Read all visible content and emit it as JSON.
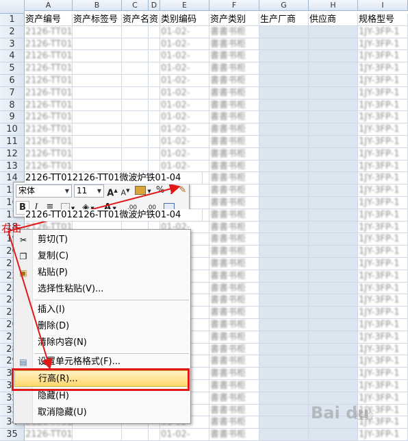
{
  "columns": [
    {
      "letter": "A",
      "header": "资产编号"
    },
    {
      "letter": "B",
      "header": "资产标签号"
    },
    {
      "letter": "C",
      "header": "资产名"
    },
    {
      "letter": "D",
      "header": "资"
    },
    {
      "letter": "E",
      "header": "类别编码"
    },
    {
      "letter": "F",
      "header": "资产类别"
    },
    {
      "letter": "G",
      "header": "生产厂商"
    },
    {
      "letter": "H",
      "header": "供应商"
    },
    {
      "letter": "I",
      "header": "规格型号"
    }
  ],
  "rows": [
    "1",
    "2",
    "3",
    "4",
    "5",
    "6",
    "7",
    "8",
    "9",
    "10",
    "11",
    "12",
    "13",
    "14",
    "15",
    "16",
    "17",
    "18",
    "19",
    "20",
    "21",
    "22",
    "23",
    "24",
    "25",
    "26",
    "27",
    "28",
    "29",
    "30",
    "31",
    "32",
    "33",
    "34",
    "35"
  ],
  "visible_row_text": {
    "r14": "2126-TT012126-TT01微波炉铁01-04",
    "r17": "2126-TT012126-TT01微波炉铁01-04"
  },
  "blurred_samples": {
    "a": "2126-TT012126-TT01",
    "e": "01-02-",
    "f": "書書书柜",
    "i": "1JY-3FP-1"
  },
  "mini_toolbar": {
    "font_name": "宋体",
    "font_size": "11",
    "grow": "A",
    "shrink": "A",
    "percent": "%",
    "comma": ",",
    "bold": "B",
    "italic": "I",
    "dec_inc": ".00",
    "dec_dec": ".00",
    "font_color_letter": "A"
  },
  "context_menu": {
    "items": [
      {
        "label": "剪切(T)"
      },
      {
        "label": "复制(C)"
      },
      {
        "label": "粘贴(P)"
      },
      {
        "label": "选择性粘贴(V)..."
      },
      {
        "label": "插入(I)"
      },
      {
        "label": "删除(D)"
      },
      {
        "label": "清除内容(N)"
      },
      {
        "label": "设置单元格格式(F)..."
      },
      {
        "label": "行高(R)..."
      },
      {
        "label": "隐藏(H)"
      },
      {
        "label": "取消隐藏(U)"
      }
    ],
    "highlighted": "行高(R)..."
  },
  "annotation": {
    "label": "右击",
    "color": "#e01818"
  },
  "watermark": {
    "brand": "Bai du",
    "suffix": "经验"
  },
  "colors": {
    "grid": "#d0d7e5",
    "header": "#dce6f2",
    "highlight": "#ffd86b",
    "accent_red": "#e01818"
  }
}
